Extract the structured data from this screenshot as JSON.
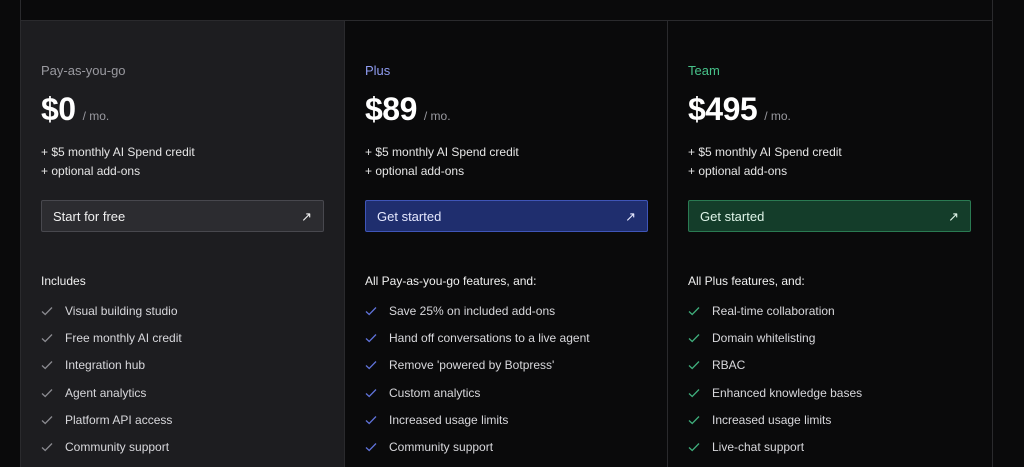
{
  "colors": {
    "payg_accent": "#9a9aa0",
    "plus_accent": "#8f9cf0",
    "team_accent": "#47c28a",
    "plus_button_bg": "#1f2e6e",
    "team_button_bg": "#143d2a"
  },
  "plans": [
    {
      "name": "Pay-as-you-go",
      "price": "$0",
      "period": "/ mo.",
      "credit": "+ $5 monthly AI Spend credit",
      "addons": "+ optional add-ons",
      "cta": "Start for free",
      "cta_icon": "arrow-up-right-icon",
      "includes_heading": "Includes",
      "features": [
        "Visual building studio",
        "Free monthly AI credit",
        "Integration hub",
        "Agent analytics",
        "Platform API access",
        "Community support"
      ]
    },
    {
      "name": "Plus",
      "price": "$89",
      "period": "/ mo.",
      "credit": "+ $5 monthly AI Spend credit",
      "addons": "+ optional add-ons",
      "cta": "Get started",
      "cta_icon": "arrow-up-right-icon",
      "includes_heading": "All Pay-as-you-go features, and:",
      "features": [
        "Save 25% on included add-ons",
        "Hand off conversations to a live agent",
        "Remove 'powered by Botpress'",
        "Custom analytics",
        "Increased usage limits",
        "Community support"
      ]
    },
    {
      "name": "Team",
      "price": "$495",
      "period": "/ mo.",
      "credit": "+ $5 monthly AI Spend credit",
      "addons": "+ optional add-ons",
      "cta": "Get started",
      "cta_icon": "arrow-up-right-icon",
      "includes_heading": "All Plus features, and:",
      "features": [
        "Real-time collaboration",
        "Domain whitelisting",
        "RBAC",
        "Enhanced knowledge bases",
        "Increased usage limits",
        "Live-chat support"
      ]
    }
  ]
}
